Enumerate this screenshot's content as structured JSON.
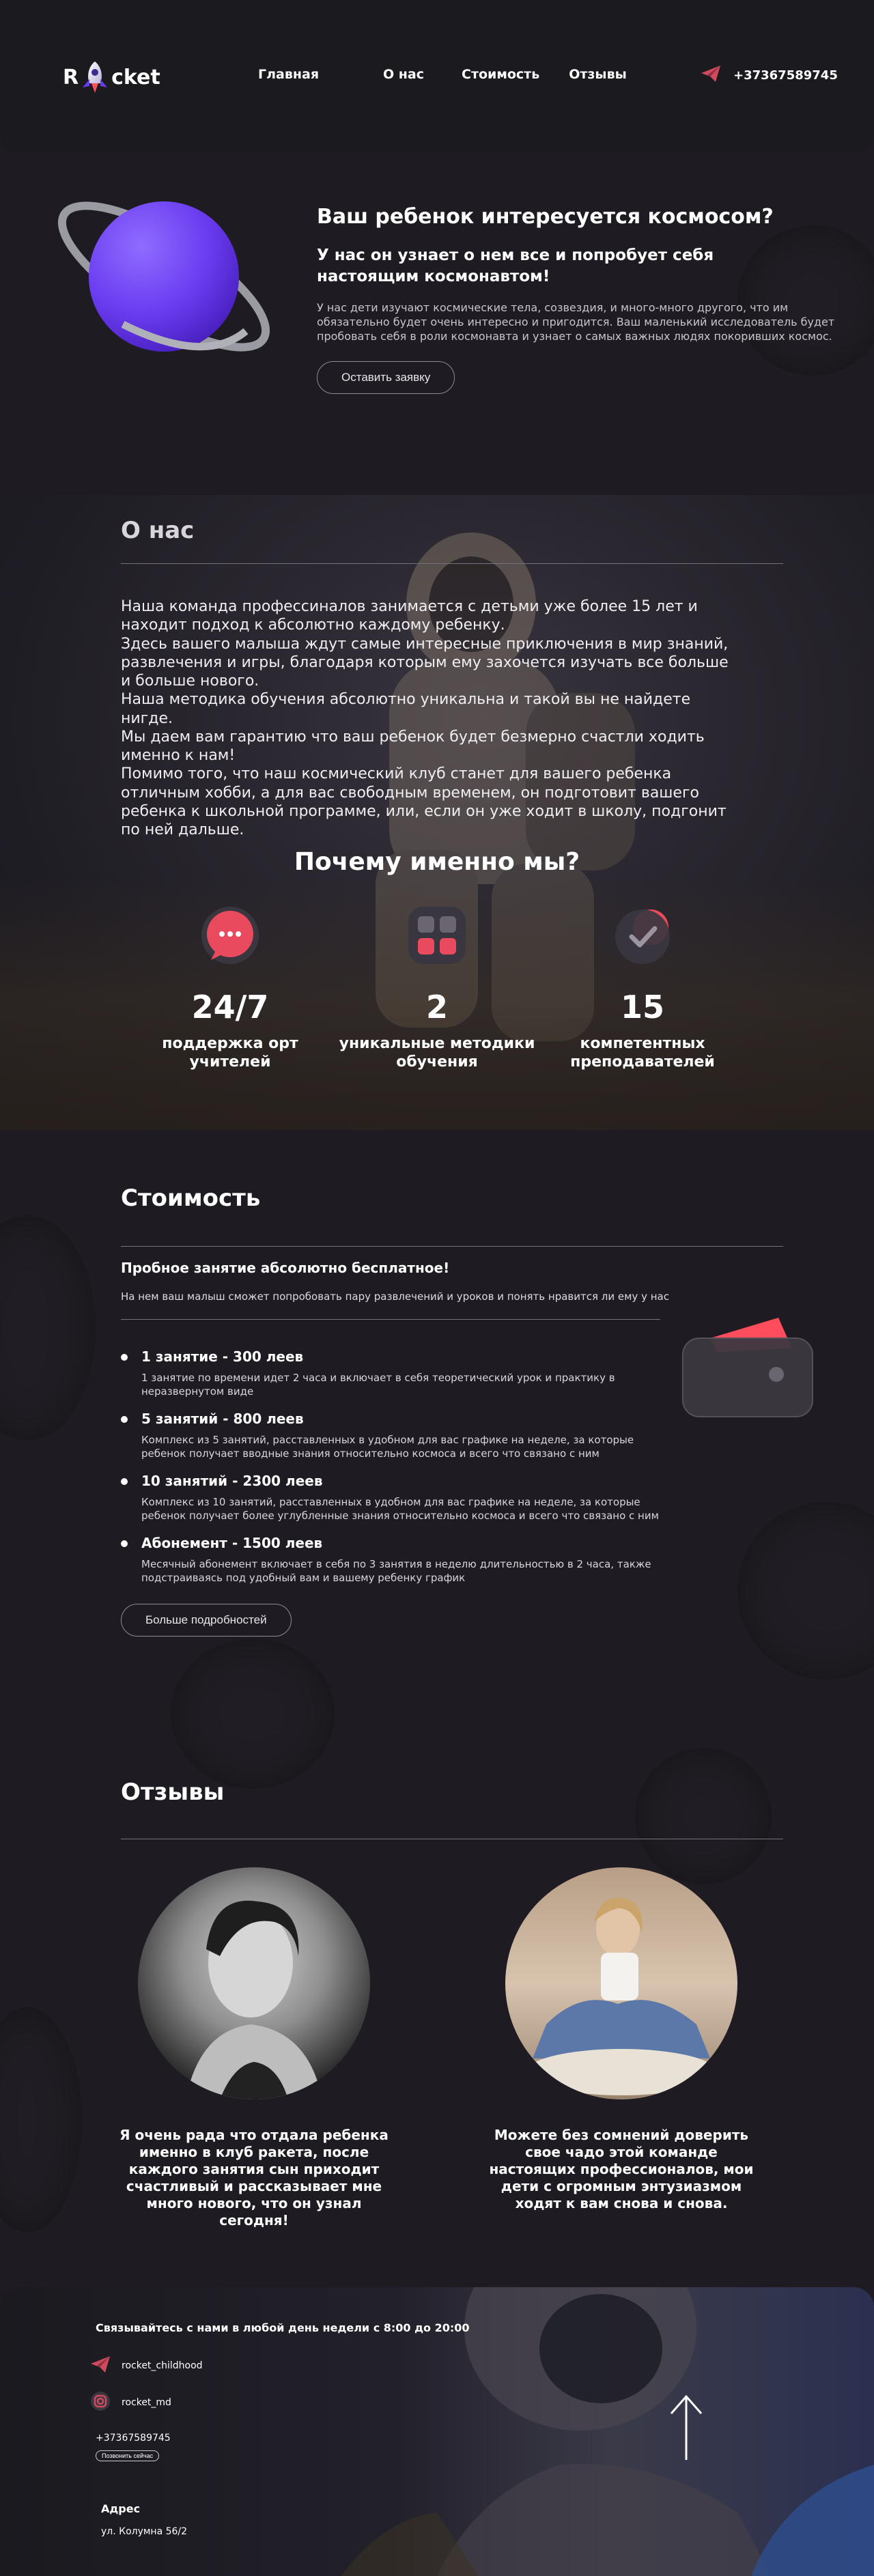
{
  "header": {
    "logo_left": "R",
    "logo_right": "cket",
    "nav": [
      "Главная",
      "О нас",
      "Стоимость",
      "Отзывы"
    ],
    "phone": "+37367589745"
  },
  "hero": {
    "title": "Ваш ребенок интересуется космосом?",
    "subtitle": "У нас он узнает о нем все и попробует себя настоящим космонавтом!",
    "description": "У нас дети изучают космические тела, созвездия, и много-много другого, что им обязательно будет очень интересно и пригодится. Ваш маленький исследователь будет пробовать себя в роли космонавта и узнает о самых важных людях покоривших космос.",
    "button": "Оставить заявку"
  },
  "about": {
    "title": "О нас",
    "paragraphs": [
      "Наша команда профессиналов занимается с детьми уже более 15 лет и находит подход к абсолютно каждому ребенку.",
      "Здесь вашего малыша ждут самые интересные приключения в мир знаний, развлечения и игры, благодаря которым ему захочется изучать все больше и больше нового.",
      "Наша методика обучения абсолютно уникальна и такой вы не найдете нигде.",
      "Мы даем вам гарантию что ваш ребенок будет безмерно счастли ходить именно к нам!",
      "Помимо того, что наш космический клуб станет для вашего ребенка отличным хобби, а для вас свободным временем, он подготовит вашего ребенка к школьной программе, или, если он уже ходит в школу, подгонит по ней дальше."
    ],
    "why_title": "Почему именно мы?",
    "features": [
      {
        "icon": "chat-icon",
        "number": "24/7",
        "label": "поддержка орт учителей"
      },
      {
        "icon": "grid-icon",
        "number": "2",
        "label": "уникальные методики обучения"
      },
      {
        "icon": "check-badge-icon",
        "number": "15",
        "label": "компетентных преподавателей"
      }
    ]
  },
  "pricing": {
    "title": "Стоимость",
    "free_title": "Пробное занятие абсолютно бесплатное!",
    "free_desc": "На нем ваш малыш сможет попробовать пару развлечений и уроков и понять нравится ли ему у нас",
    "items": [
      {
        "name": "1 занятие - 300 леев",
        "desc": "1 занятие по времени идет 2 часа и включает в себя теоретический урок и практику в неразвернутом виде"
      },
      {
        "name": "5 занятий - 800 леев",
        "desc": "Комплекс из 5 занятий, расставленных в удобном для вас графике на неделе, за которые ребенок получает вводные знания относительно космоса и всего что связано с ним"
      },
      {
        "name": "10 занятий - 2300 леев",
        "desc": "Комплекс из 10 занятий, расставленных в удобном для вас графике на неделе, за которые ребенок получает более углубленные знания относительно космоса и всего что связано с ним"
      },
      {
        "name": "Абонемент - 1500 леев",
        "desc": "Месячный абонемент включает в себя по 3 занятия в неделю длительностью в 2 часа, также подстраиваясь под удобный вам и вашему ребенку график"
      }
    ],
    "button": "Больше подробностей"
  },
  "reviews": {
    "title": "Отзывы",
    "items": [
      {
        "text": "Я очень рада что отдала ребенка именно в клуб ракета, после каждого занятия сын приходит счастливый и рассказывает мне много нового, что он узнал сегодня!"
      },
      {
        "text": "Можете без сомнений доверить свое чадо этой команде настоящих профессионалов, мои дети с огромным энтузиазмом ходят к вам снова и снова."
      }
    ]
  },
  "footer": {
    "title": "Связывайтесь с нами в любой день недели с 8:00 до 20:00",
    "telegram": "rocket_childhood",
    "instagram": "rocket_md",
    "phone": "+37367589745",
    "call_button": "Позвонить сейчас",
    "address_title": "Адрес",
    "address": "ул. Колумна 56/2"
  },
  "colors": {
    "background": "#1e1c22",
    "accent_red": "#ff4d5e",
    "planet_purple": "#6a3cf0"
  }
}
